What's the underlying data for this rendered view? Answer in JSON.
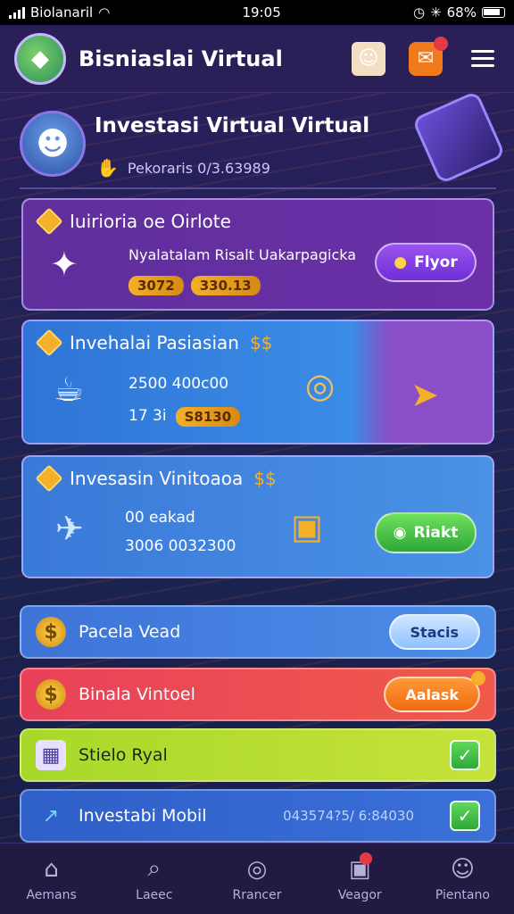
{
  "status_bar": {
    "carrier": "Biolanaril",
    "time": "19:05",
    "battery": "68%"
  },
  "header": {
    "title": "Bisniaslai Virtual"
  },
  "profile": {
    "name": "Investasi Virtual Virtual",
    "subtitle": "Pekoraris 0/3.63989"
  },
  "cards": [
    {
      "title": "Iuirioria oe Oirlote",
      "desc": "Nyalatalam Risalt Uakarpagicka",
      "pill_a": "3072",
      "pill_b": "330.13",
      "action": "Flyor"
    },
    {
      "title": "Invehalai Pasiasian",
      "line1": "2500 400c00",
      "line2": "17 3i",
      "pill": "S8130"
    },
    {
      "title": "Invesasin Vinitoaoa",
      "line1": "00 eakad",
      "line2": "3006 0032300",
      "action": "Riakt"
    }
  ],
  "list": [
    {
      "label": "Pacela Vead",
      "button": "Stacis"
    },
    {
      "label": "Binala Vintoel",
      "button": "Aalask"
    },
    {
      "label": "Stielo Ryal"
    },
    {
      "label": "Investabi Mobil",
      "extra": "043574?5/ 6:84030"
    }
  ],
  "nav": [
    {
      "label": "Aemans"
    },
    {
      "label": "Laeec"
    },
    {
      "label": "Rrancer"
    },
    {
      "label": "Veagor"
    },
    {
      "label": "Pientano"
    }
  ]
}
